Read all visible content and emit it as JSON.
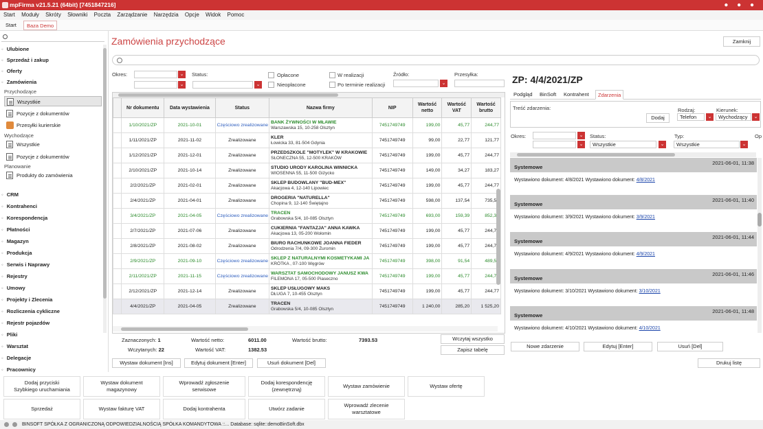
{
  "window_title": "mpFirma v21.5.21 (64bit) [7451847216]",
  "menu": [
    "Start",
    "Moduły",
    "Skróty",
    "Słowniki",
    "Poczta",
    "Zarządzanie",
    "Narzędzia",
    "Opcje",
    "Widok",
    "Pomoc"
  ],
  "top_tabs": {
    "start": "Start",
    "baza": "Baza Demo"
  },
  "sidebar": {
    "items_top": [
      "Ulubione",
      "Sprzedaż i zakup",
      "Oferty",
      "Zamówienia"
    ],
    "section_przychodzace": "Przychodzące",
    "przychodzace": [
      "Wszystkie",
      "Pozycje z dokumentów",
      "Przesyłki kurierskie"
    ],
    "section_wychodzace": "Wychodzące",
    "wychodzace": [
      "Wszystkie",
      "Pozycje z dokumentów"
    ],
    "section_planowanie": "Planowanie",
    "planowanie": [
      "Produkty do zamówienia"
    ],
    "items_bottom": [
      "CRM",
      "Kontrahenci",
      "Korespondencja",
      "Płatności",
      "Magazyn",
      "Produkcja",
      "Serwis i Naprawy",
      "Rejestry",
      "Umowy",
      "Projekty i Zlecenia",
      "Rozliczenia cykliczne",
      "Rejestr pojazdów",
      "Pliki",
      "Warsztat",
      "Delegacje",
      "Pracownicy"
    ]
  },
  "page_title": "Zamówienia przychodzące",
  "close_label": "Zamknij",
  "filters": {
    "okres": "Okres:",
    "status": "Status:",
    "oplacone": "Opłacone",
    "nieoplacone": "Nieopłacone",
    "w_realizacji": "W realizacji",
    "po_terminie": "Po terminie realizacji",
    "zrodlo": "Źródło:",
    "przesylka": "Przesyłka:"
  },
  "table": {
    "headers": [
      "Nr dokumentu",
      "Data wystawienia",
      "Status",
      "Nazwa firmy",
      "NIP",
      "Wartość netto",
      "Wartość VAT",
      "Wartość brutto"
    ],
    "rows": [
      {
        "nr": "1/10/2021/ZP",
        "date": "2021-10-01",
        "status": "Częściowo zrealizowane",
        "name": "BANK ŻYWNOŚCI W MŁAWIE",
        "addr": "Warszawska 15, 10-258 Olsztyn",
        "nip": "7451749749",
        "netto": "199,00",
        "vat": "45,77",
        "brutto": "244,77",
        "green": true
      },
      {
        "nr": "1/11/2021/ZP",
        "date": "2021-11-02",
        "status": "Zrealizowane",
        "name": "KLER",
        "addr": "Łowicka 33, 81-504 Gdynia",
        "nip": "7451749749",
        "netto": "99,00",
        "vat": "22,77",
        "brutto": "121,77",
        "green": false
      },
      {
        "nr": "1/12/2021/ZP",
        "date": "2021-12-01",
        "status": "Zrealizowane",
        "name": "PRZEDSZKOLE \"MOTYLEK\" W KRAKOWIE",
        "addr": "SŁONECZNA 55, 12-500 KRAKÓW",
        "nip": "7451749749",
        "netto": "199,00",
        "vat": "45,77",
        "brutto": "244,77",
        "green": false
      },
      {
        "nr": "2/10/2021/ZP",
        "date": "2021-10-14",
        "status": "Zrealizowane",
        "name": "STUDIO URODY KAROLINA WINNICKA",
        "addr": "WIOSENNA 55, 11-500 Giżycko",
        "nip": "7451749749",
        "netto": "149,00",
        "vat": "34,27",
        "brutto": "183,27",
        "green": false
      },
      {
        "nr": "2/2/2021/ZP",
        "date": "2021-02-01",
        "status": "Zrealizowane",
        "name": "SKLEP BUDOWLANY \"BUD-MEX\"",
        "addr": "Akacjowa 4, 12-140 Lipowiec",
        "nip": "7451749749",
        "netto": "199,00",
        "vat": "45,77",
        "brutto": "244,77",
        "green": false
      },
      {
        "nr": "2/4/2021/ZP",
        "date": "2021-04-01",
        "status": "Zrealizowane",
        "name": "DROGERIA \"NATURELLA\"",
        "addr": "Chopina 9, 12-140 Świętajno",
        "nip": "7451749749",
        "netto": "598,00",
        "vat": "137,54",
        "brutto": "735,54",
        "green": false
      },
      {
        "nr": "3/4/2021/ZP",
        "date": "2021-04-05",
        "status": "Częściowo zrealizowane",
        "name": "TRACEN",
        "addr": "Grabowska 5/4, 10-085 Olsztyn",
        "nip": "7451749749",
        "netto": "693,00",
        "vat": "159,39",
        "brutto": "852,39",
        "green": true
      },
      {
        "nr": "2/7/2021/ZP",
        "date": "2021-07-06",
        "status": "Zrealizowane",
        "name": "CUKIERNIA \"FANTAZJA\" ANNA KAWKA",
        "addr": "Akacjowa 13, 05-200 Wołomin",
        "nip": "7451749749",
        "netto": "199,00",
        "vat": "45,77",
        "brutto": "244,77",
        "green": false
      },
      {
        "nr": "2/8/2021/ZP",
        "date": "2021-08-02",
        "status": "Zrealizowane",
        "name": "BIURO RACHUNKOWE JOANNA FIEDER",
        "addr": "Odrodzenia 7/4, 09-300 Żuromin",
        "nip": "7451749749",
        "netto": "199,00",
        "vat": "45,77",
        "brutto": "244,77",
        "green": false
      },
      {
        "nr": "2/9/2021/ZP",
        "date": "2021-09-10",
        "status": "Częściowo zrealizowane",
        "name": "SKLEP Z NATURALNYMI KOSMETYKAMI JA",
        "addr": "KRÓTKA , 07-100 Węgrów",
        "nip": "7451749749",
        "netto": "398,00",
        "vat": "91,54",
        "brutto": "489,54",
        "green": true
      },
      {
        "nr": "2/11/2021/ZP",
        "date": "2021-11-15",
        "status": "Częściowo zrealizowane",
        "name": "WARSZTAT SAMOCHODOWY JANUSZ KWA",
        "addr": "FILEMONA 17, 05-500 Piaseczno",
        "nip": "7451749749",
        "netto": "199,00",
        "vat": "45,77",
        "brutto": "244,77",
        "green": true
      },
      {
        "nr": "2/12/2021/ZP",
        "date": "2021-12-14",
        "status": "Zrealizowane",
        "name": "SKLEP USŁUGOWY MAKS",
        "addr": "DŁUGA 7, 10-455 Olsztyn",
        "nip": "7451749749",
        "netto": "199,00",
        "vat": "45,77",
        "brutto": "244,77",
        "green": false
      },
      {
        "nr": "4/4/2021/ZP",
        "date": "2021-04-05",
        "status": "Zrealizowane",
        "name": "TRACEN",
        "addr": "Grabowska 5/4, 10-085 Olsztyn",
        "nip": "7451749749",
        "netto": "1 240,00",
        "vat": "285,20",
        "brutto": "1 525,20",
        "green": false,
        "selected": true
      }
    ]
  },
  "summary": {
    "zaznaczonych_label": "Zaznaczonych:",
    "zaznaczonych": "1",
    "wczytanych_label": "Wczytanych:",
    "wczytanych": "22",
    "netto_label": "Wartość netto:",
    "netto": "6011.00",
    "vat_label": "Wartość VAT:",
    "vat": "1382.53",
    "brutto_label": "Wartość brutto:",
    "brutto": "7393.53",
    "wczytaj": "Wczytaj wszystko",
    "zapisz": "Zapisz tabelę"
  },
  "doc_buttons": {
    "wystaw": "Wystaw dokument [Ins]",
    "edytuj": "Edytuj dokument [Enter]",
    "usun": "Usuń dokument [Del]"
  },
  "right": {
    "title": "ZP: 4/4/2021/ZP",
    "tabs": [
      "Podgląd",
      "BinSoft",
      "Kontrahent",
      "Zdarzenia"
    ],
    "tresc_label": "Treść zdarzenia:",
    "dodaj": "Dodaj",
    "rodzaj_label": "Rodzaj:",
    "rodzaj": "Telefon",
    "kierunek_label": "Kierunek:",
    "kierunek": "Wychodzący",
    "okres_label": "Okres:",
    "status_label": "Status:",
    "status_val": "Wszystkie",
    "typ_label": "Typ:",
    "typ_val": "Wszystkie",
    "op_label": "Op",
    "events": [
      {
        "type": "Systemowe",
        "date": "2021-06-01, 11:38",
        "text": "Wystawiono dokument: 4/8/2021 Wystawiono dokument: ",
        "link": "4/8/2021"
      },
      {
        "type": "Systemowe",
        "date": "2021-06-01, 11:40",
        "text": "Wystawiono dokument: 3/9/2021 Wystawiono dokument: ",
        "link": "3/9/2021"
      },
      {
        "type": "Systemowe",
        "date": "2021-06-01, 11:44",
        "text": "Wystawiono dokument: 4/9/2021 Wystawiono dokument: ",
        "link": "4/9/2021"
      },
      {
        "type": "Systemowe",
        "date": "2021-06-01, 11:46",
        "text": "Wystawiono dokument: 3/10/2021 Wystawiono dokument: ",
        "link": "3/10/2021"
      },
      {
        "type": "Systemowe",
        "date": "2021-06-01, 11:48",
        "text": "Wystawiono dokument: 4/10/2021 Wystawiono dokument: ",
        "link": "4/10/2021"
      }
    ],
    "nowe": "Nowe zdarzenie",
    "edytuj": "Edytuj [Enter]",
    "usun": "Usuń [Del]"
  },
  "drukuj": "Drukuj listę",
  "quick_actions": [
    [
      "Dodaj przyciski\nSzybkiego uruchamiania",
      "Wystaw dokument\nmagazynowy",
      "Wprowadź zgłoszenie\nserwisowe",
      "Dodaj korespondencję\n(zewnętrzną)",
      "Wystaw zamówienie",
      "Wystaw ofertę"
    ],
    [
      "Sprzedaż",
      "Wystaw fakturę VAT",
      "Dodaj kontrahenta",
      "Utwórz zadanie",
      "Wprowadź zlecenie\nwarsztatowe"
    ]
  ],
  "statusbar": "BINSOFT SPÓŁKA Z OGRANICZONĄ ODPOWIEDZIALNOŚCIĄ SPÓŁKA KOMANDYTOWA ::... Database: sqlite::demoBinSoft.dbx",
  "colors": {
    "accent": "#cc3333",
    "green_text": "#2a8a2a",
    "link": "#1a44aa"
  }
}
